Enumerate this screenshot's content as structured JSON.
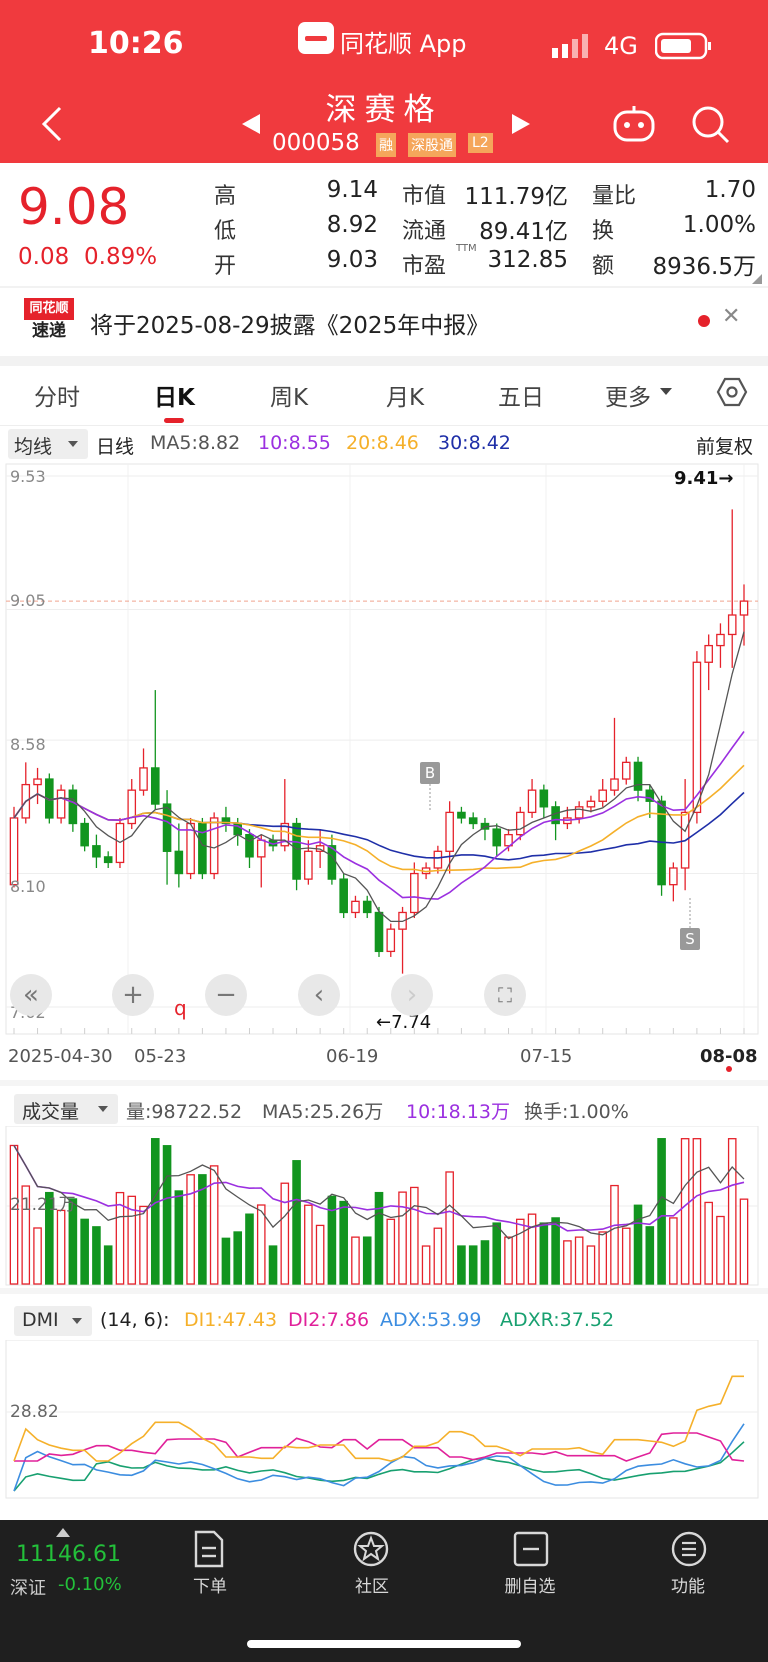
{
  "status": {
    "time": "10:26",
    "app": "同花顺 App",
    "network": "4G"
  },
  "header": {
    "name": "深赛格",
    "code": "000058",
    "badges": [
      "融",
      "深股通",
      "L2"
    ]
  },
  "quote": {
    "price": "9.08",
    "change": "0.08",
    "change_pct": "0.89%",
    "high_label": "高",
    "high": "9.14",
    "low_label": "低",
    "low": "8.92",
    "open_label": "开",
    "open": "9.03",
    "mktcap_label": "市值",
    "mktcap": "111.79亿",
    "float_label": "流通",
    "float": "89.41亿",
    "pe_label": "市盈",
    "pe_sup": "TTM",
    "pe": "312.85",
    "vr_label": "量比",
    "vr": "1.70",
    "turn_label": "换",
    "turn": "1.00%",
    "amt_label": "额",
    "amt": "8936.5万"
  },
  "notice": {
    "logo_top": "同花顺",
    "logo_bottom": "速递",
    "text": "将于2025-08-29披露《2025年中报》"
  },
  "tabs": [
    "分时",
    "日K",
    "周K",
    "月K",
    "五日",
    "更多"
  ],
  "ma_bar": {
    "dropdown": "均线",
    "period": "日线",
    "ma5": "MA5:8.82",
    "ma10": "10:8.55",
    "ma20": "20:8.46",
    "ma30": "30:8.42",
    "adjust": "前复权"
  },
  "colors": {
    "up": "#e5222b",
    "down": "#12951f",
    "ma5": "#555555",
    "ma10": "#9b30e0",
    "ma20": "#f5b02a",
    "ma30": "#1f2fa8",
    "topbar": "#f03a3e"
  },
  "price_axis": {
    "top": "9.53",
    "mid1": "9.05",
    "mid2": "8.58",
    "mid3": "8.10",
    "bottom": "7.62"
  },
  "annotations": {
    "max": "9.41→",
    "min": "←7.74",
    "buy_mark": "B",
    "sell_mark": "S",
    "q_mark": "q"
  },
  "dates": [
    "2025-04-30",
    "05-23",
    "06-19",
    "07-15",
    "08-08"
  ],
  "volume_bar": {
    "dropdown": "成交量",
    "vol": "量:98722.52",
    "ma5": "MA5:25.26万",
    "ma10": "10:18.13万",
    "turnover": "换手:1.00%",
    "axis": "21.21万"
  },
  "dmi_bar": {
    "dropdown": "DMI",
    "params": "(14, 6):",
    "di1": "DI1:47.43",
    "di2": "DI2:7.86",
    "adx": "ADX:53.99",
    "adxr": "ADXR:37.52",
    "axis": "28.82"
  },
  "dmi_colors": {
    "di1": "#f5b02a",
    "di2": "#e0219a",
    "adx": "#3c8de0",
    "adxr": "#18a070"
  },
  "bottom_nav": {
    "index_value": "11146.61",
    "index_name": "深证",
    "index_change": "-0.10%",
    "items": [
      "下单",
      "社区",
      "删自选",
      "功能"
    ]
  },
  "chart_data": {
    "type": "candlestick",
    "ylim": [
      7.62,
      9.53
    ],
    "candles": [
      [
        8.06,
        8.3,
        8.05,
        8.34
      ],
      [
        8.3,
        8.42,
        8.28,
        8.5
      ],
      [
        8.42,
        8.44,
        8.35,
        8.48
      ],
      [
        8.44,
        8.3,
        8.28,
        8.46
      ],
      [
        8.3,
        8.4,
        8.28,
        8.42
      ],
      [
        8.4,
        8.28,
        8.25,
        8.42
      ],
      [
        8.28,
        8.2,
        8.18,
        8.3
      ],
      [
        8.2,
        8.16,
        8.12,
        8.24
      ],
      [
        8.16,
        8.14,
        8.12,
        8.18
      ],
      [
        8.14,
        8.28,
        8.12,
        8.3
      ],
      [
        8.28,
        8.4,
        8.26,
        8.44
      ],
      [
        8.4,
        8.48,
        8.38,
        8.55
      ],
      [
        8.48,
        8.35,
        8.33,
        8.76
      ],
      [
        8.35,
        8.18,
        8.06,
        8.4
      ],
      [
        8.18,
        8.1,
        8.05,
        8.28
      ],
      [
        8.1,
        8.28,
        8.08,
        8.3
      ],
      [
        8.28,
        8.1,
        8.08,
        8.3
      ],
      [
        8.1,
        8.3,
        8.08,
        8.32
      ],
      [
        8.3,
        8.28,
        8.25,
        8.34
      ],
      [
        8.28,
        8.24,
        8.2,
        8.3
      ],
      [
        8.24,
        8.16,
        8.12,
        8.26
      ],
      [
        8.16,
        8.22,
        8.05,
        8.24
      ],
      [
        8.22,
        8.2,
        8.18,
        8.24
      ],
      [
        8.2,
        8.28,
        8.18,
        8.44
      ],
      [
        8.28,
        8.08,
        8.04,
        8.3
      ],
      [
        8.08,
        8.18,
        8.06,
        8.22
      ],
      [
        8.18,
        8.2,
        8.12,
        8.26
      ],
      [
        8.2,
        8.08,
        8.06,
        8.24
      ],
      [
        8.08,
        7.96,
        7.94,
        8.1
      ],
      [
        7.96,
        8.0,
        7.94,
        8.02
      ],
      [
        8.0,
        7.96,
        7.94,
        8.02
      ],
      [
        7.96,
        7.82,
        7.8,
        7.98
      ],
      [
        7.82,
        7.9,
        7.8,
        7.92
      ],
      [
        7.9,
        7.96,
        7.74,
        7.98
      ],
      [
        7.96,
        8.1,
        7.94,
        8.14
      ],
      [
        8.1,
        8.12,
        8.08,
        8.14
      ],
      [
        8.12,
        8.18,
        8.1,
        8.2
      ],
      [
        8.18,
        8.32,
        8.1,
        8.36
      ],
      [
        8.32,
        8.3,
        8.28,
        8.34
      ],
      [
        8.3,
        8.28,
        8.26,
        8.32
      ],
      [
        8.28,
        8.26,
        8.22,
        8.3
      ],
      [
        8.26,
        8.2,
        8.16,
        8.28
      ],
      [
        8.2,
        8.24,
        8.18,
        8.26
      ],
      [
        8.24,
        8.32,
        8.22,
        8.34
      ],
      [
        8.32,
        8.4,
        8.3,
        8.44
      ],
      [
        8.4,
        8.34,
        8.3,
        8.42
      ],
      [
        8.34,
        8.28,
        8.22,
        8.36
      ],
      [
        8.28,
        8.3,
        8.26,
        8.34
      ],
      [
        8.3,
        8.34,
        8.28,
        8.36
      ],
      [
        8.34,
        8.36,
        8.32,
        8.38
      ],
      [
        8.36,
        8.4,
        8.34,
        8.44
      ],
      [
        8.4,
        8.44,
        8.38,
        8.66
      ],
      [
        8.44,
        8.5,
        8.42,
        8.52
      ],
      [
        8.5,
        8.4,
        8.36,
        8.52
      ],
      [
        8.4,
        8.36,
        8.3,
        8.42
      ],
      [
        8.36,
        8.06,
        8.02,
        8.38
      ],
      [
        8.06,
        8.12,
        8.0,
        8.14
      ],
      [
        8.12,
        8.32,
        8.04,
        8.44
      ],
      [
        8.32,
        8.86,
        8.28,
        8.9
      ],
      [
        8.86,
        8.92,
        8.76,
        8.96
      ],
      [
        8.92,
        8.96,
        8.84,
        9.0
      ],
      [
        8.96,
        9.03,
        8.84,
        9.41
      ],
      [
        9.03,
        9.08,
        8.92,
        9.14
      ]
    ],
    "volume_ylim": [
      0,
      32
    ],
    "dmi_ylim": [
      0,
      60
    ]
  }
}
